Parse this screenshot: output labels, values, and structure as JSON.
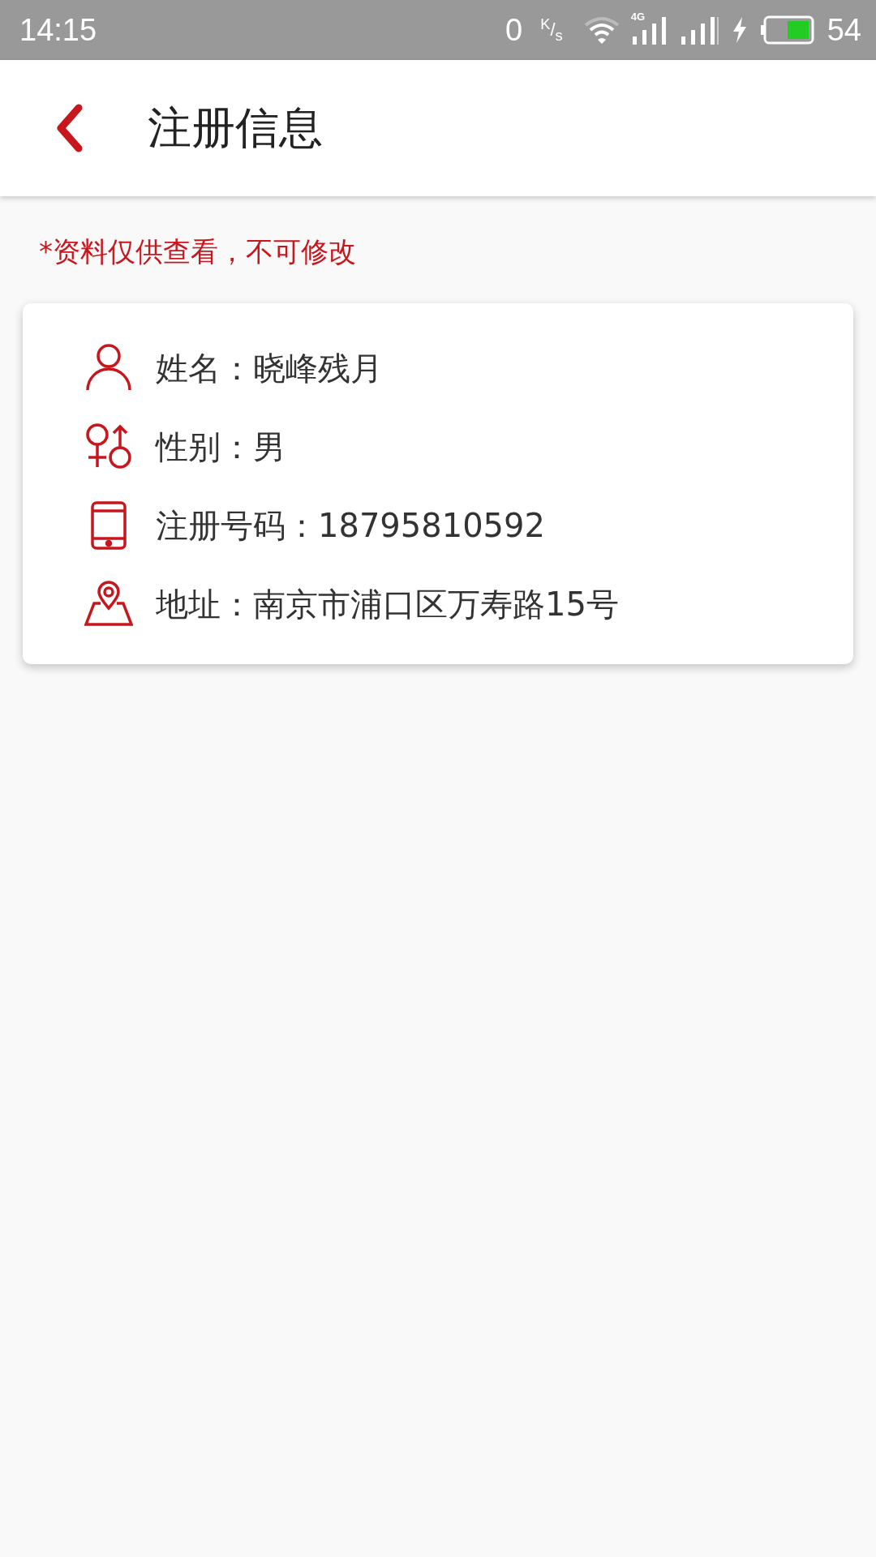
{
  "status_bar": {
    "time": "14:15",
    "speed": "0",
    "speed_unit": "$^{K}$/$_{s}$",
    "network": "4G",
    "battery": "54"
  },
  "header": {
    "title": "注册信息"
  },
  "notice": "*资料仅供查看，不可修改",
  "fields": [
    {
      "kind": "person",
      "text": "姓名：晓峰残月"
    },
    {
      "kind": "gender",
      "text": "性别：男"
    },
    {
      "kind": "phone",
      "text": "注册号码：18795810592"
    },
    {
      "kind": "location",
      "text": "地址：南京市浦口区万寿路15号"
    }
  ]
}
